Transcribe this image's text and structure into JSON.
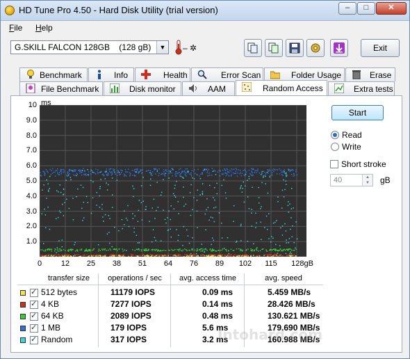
{
  "window": {
    "title": "HD Tune Pro 4.50 - Hard Disk Utility (trial version)",
    "controls": {
      "minimize": "–",
      "maximize": "□",
      "close": "✕"
    }
  },
  "menu": [
    {
      "label": "File",
      "mnemonic": "F",
      "rest": "ile"
    },
    {
      "label": "Help",
      "mnemonic": "H",
      "rest": "elp"
    }
  ],
  "toolbar": {
    "drive": "G.SKILL FALCON 128GB    (128 gB)",
    "temperature": "– ✲",
    "exit_label": "Exit",
    "icons": [
      "copy-info-icon",
      "copy-screenshot-icon",
      "save-icon",
      "options-icon",
      "download-icon"
    ]
  },
  "tabs": {
    "row1": [
      "Benchmark",
      "Info",
      "Health",
      "Error Scan",
      "Folder Usage",
      "Erase"
    ],
    "row2": [
      "File Benchmark",
      "Disk monitor",
      "AAM",
      "Random Access",
      "Extra tests"
    ],
    "active": "Random Access"
  },
  "controls": {
    "start_label": "Start",
    "read_label": "Read",
    "write_label": "Write",
    "mode_selected": "Read",
    "short_stroke_label": "Short stroke",
    "short_stroke_checked": false,
    "short_stroke_value": "40",
    "short_stroke_unit": "gB"
  },
  "chart_data": {
    "type": "scatter",
    "ylabel": "ms",
    "y_ticks": [
      "10",
      "9.0",
      "8.0",
      "7.0",
      "6.0",
      "5.0",
      "4.0",
      "3.0",
      "2.0",
      "1.0"
    ],
    "x_ticks": [
      "0",
      "12",
      "25",
      "38",
      "51",
      "64",
      "76",
      "89",
      "102",
      "115",
      "128gB"
    ],
    "xlim": [
      0,
      128
    ],
    "ylim": [
      0,
      10
    ],
    "grid": true,
    "series": [
      {
        "name": "512 bytes",
        "color": "#f3e04a",
        "typical_ms": 0.09
      },
      {
        "name": "4 KB",
        "color": "#c8311e",
        "typical_ms": 0.14
      },
      {
        "name": "64 KB",
        "color": "#3cc83c",
        "typical_ms": 0.48
      },
      {
        "name": "1 MB",
        "color": "#2f6fd6",
        "typical_ms": 5.6
      },
      {
        "name": "Random",
        "color": "#3fd0d8",
        "typical_ms": 3.2
      }
    ]
  },
  "results": {
    "headers": [
      "transfer size",
      "operations / sec",
      "avg. access time",
      "avg. speed"
    ],
    "rows": [
      {
        "size": "512 bytes",
        "ops": "11179 IOPS",
        "time": "0.09 ms",
        "speed": "5.459 MB/s",
        "checked": true
      },
      {
        "size": "4 KB",
        "ops": "7277 IOPS",
        "time": "0.14 ms",
        "speed": "28.426 MB/s",
        "checked": true
      },
      {
        "size": "64 KB",
        "ops": "2089 IOPS",
        "time": "0.48 ms",
        "speed": "130.621 MB/s",
        "checked": true
      },
      {
        "size": "1 MB",
        "ops": "179 IOPS",
        "time": "5.6 ms",
        "speed": "179.690 MB/s",
        "checked": true
      },
      {
        "size": "Random",
        "ops": "317 IOPS",
        "time": "3.2 ms",
        "speed": "160.988 MB/s",
        "checked": true
      }
    ]
  },
  "watermark": "Intohard.com"
}
